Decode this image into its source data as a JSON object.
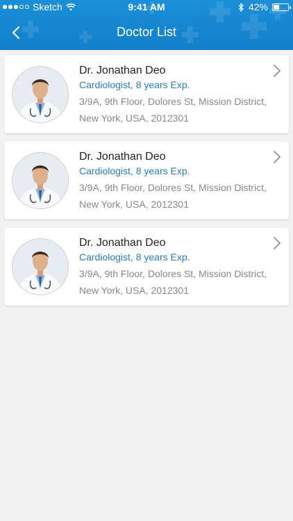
{
  "status_bar": {
    "carrier": "Sketch",
    "time": "9:41 AM",
    "battery_pct": "42%",
    "battery_level": 0.42,
    "icons": [
      "signal-dots-icon",
      "wifi-icon",
      "bluetooth-icon",
      "battery-icon"
    ]
  },
  "header": {
    "title": "Doctor List",
    "back_icon": "chevron-left-icon",
    "background": "#1787d2"
  },
  "colors": {
    "accent": "#2a7bbd",
    "name_text": "#222222",
    "address_text": "#888888",
    "background": "#f2f2f2"
  },
  "doctors": [
    {
      "name": "Dr. Jonathan Deo",
      "specialty": "Cardiologist, 8 years Exp.",
      "address_line1": "3/9A, 9th Floor, Dolores St, Mission District,",
      "address_line2": "New York, USA, 2012301"
    },
    {
      "name": "Dr. Jonathan Deo",
      "specialty": "Cardiologist, 8 years Exp.",
      "address_line1": "3/9A, 9th Floor, Dolores St, Mission District,",
      "address_line2": "New York, USA, 2012301"
    },
    {
      "name": "Dr. Jonathan Deo",
      "specialty": "Cardiologist, 8 years Exp.",
      "address_line1": "3/9A, 9th Floor, Dolores St, Mission District,",
      "address_line2": "New York, USA, 2012301"
    }
  ]
}
